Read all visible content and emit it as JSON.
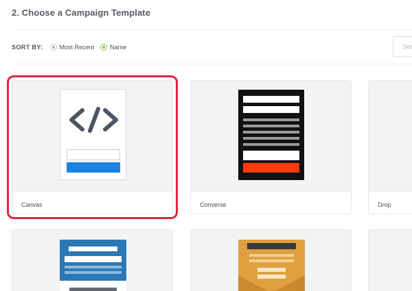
{
  "header": {
    "title": "2. Choose a Campaign Template"
  },
  "sort": {
    "label": "SORT BY:",
    "options": [
      {
        "label": "Most Recent",
        "checked": false
      },
      {
        "label": "Name",
        "checked": true
      }
    ]
  },
  "search": {
    "placeholder": "Search"
  },
  "templates": [
    {
      "name": "Canvas",
      "selected": true
    },
    {
      "name": "Converse",
      "selected": false
    },
    {
      "name": "Drop",
      "selected": false
    }
  ],
  "colors": {
    "accent_selected": "#e0253f",
    "radio_checked": "#8bc34a",
    "canvas_button": "#1a82e2",
    "converse_button": "#ff3b0a",
    "blue_template": "#2c78b5",
    "orange_template": "#e0a040"
  }
}
